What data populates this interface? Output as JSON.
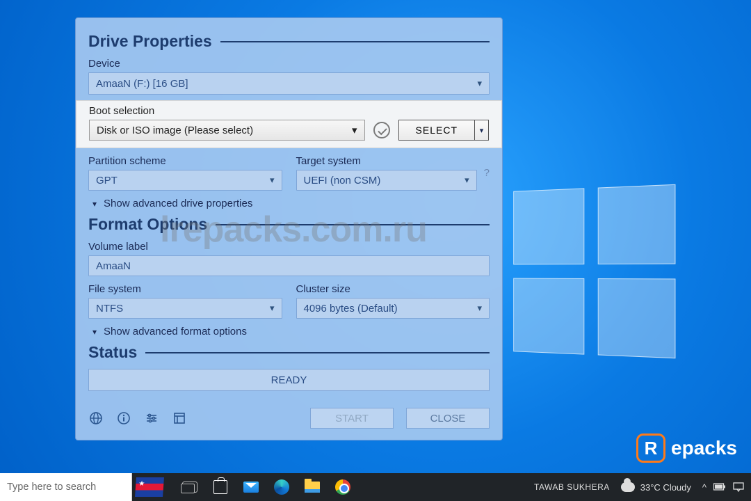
{
  "watermark": "lrepacks.com.ru",
  "repacks_brand": "epacks",
  "dialog": {
    "sections": {
      "drive_properties": "Drive Properties",
      "format_options": "Format Options",
      "status": "Status"
    },
    "device_label": "Device",
    "device_value": "AmaaN (F:) [16 GB]",
    "boot_label": "Boot selection",
    "boot_value": "Disk or ISO image (Please select)",
    "select_button": "SELECT",
    "partition_label": "Partition scheme",
    "partition_value": "GPT",
    "target_label": "Target system",
    "target_value": "UEFI (non CSM)",
    "target_help": "?",
    "adv_drive": "Show advanced drive properties",
    "volume_label_label": "Volume label",
    "volume_label_value": "AmaaN",
    "filesystem_label": "File system",
    "filesystem_value": "NTFS",
    "cluster_label": "Cluster size",
    "cluster_value": "4096 bytes (Default)",
    "adv_format": "Show advanced format options",
    "status_value": "READY",
    "start_button": "START",
    "close_button": "CLOSE"
  },
  "taskbar": {
    "search_placeholder": "Type here to search",
    "user": "TAWAB SUKHERA",
    "weather": "33°C  Cloudy"
  }
}
